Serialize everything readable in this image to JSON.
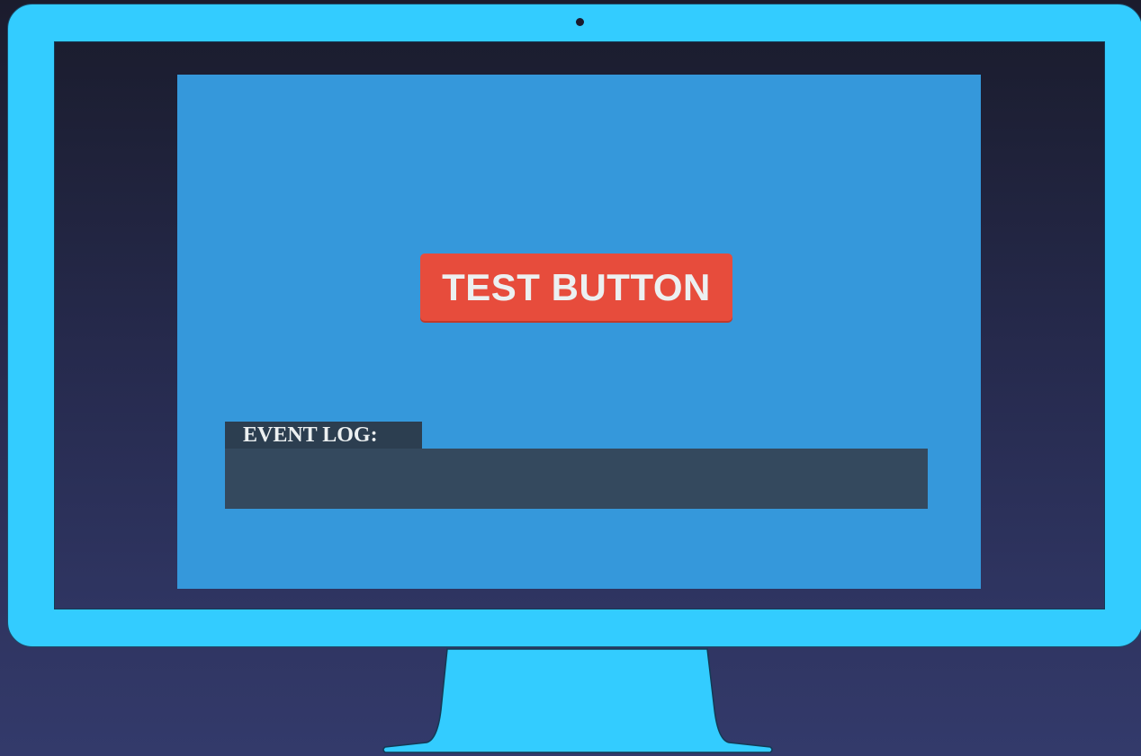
{
  "app": {
    "test_button_label": "TEST BUTTON",
    "event_log_label": "EVENT LOG:",
    "event_log_entries": []
  },
  "colors": {
    "bezel": "#33ccff",
    "viewport_background": "#3598db",
    "button_background": "#e74c3c",
    "button_text": "#ecf0f1",
    "log_label_background": "#2c3e50",
    "log_area_background": "#34495e"
  }
}
